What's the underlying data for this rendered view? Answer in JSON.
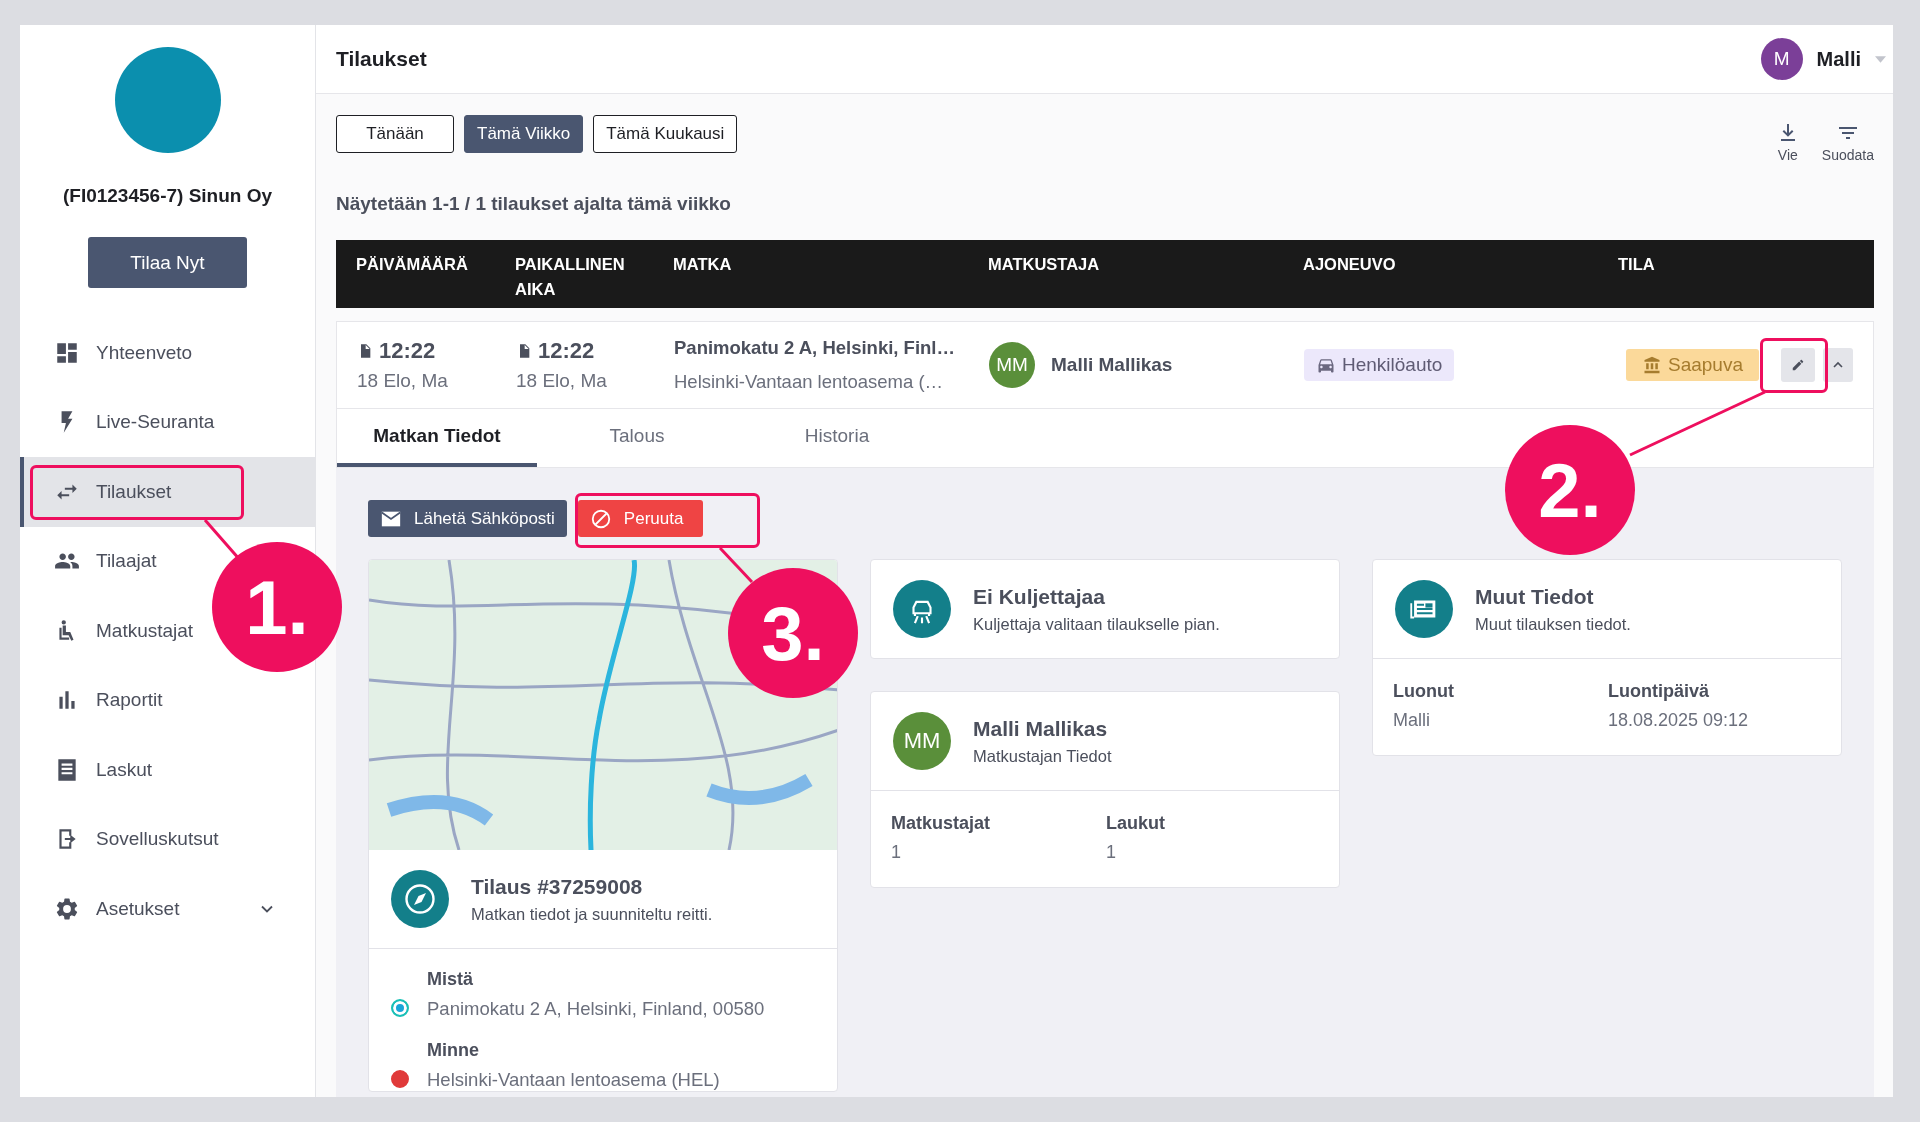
{
  "sidebar": {
    "company": "(FI0123456-7) Sinun Oy",
    "order_button": "Tilaa Nyt",
    "items": [
      {
        "label": "Yhteenveto",
        "kind": "dashboard",
        "selected": false
      },
      {
        "label": "Live-Seuranta",
        "kind": "bolt",
        "selected": false
      },
      {
        "label": "Tilaukset",
        "kind": "swap",
        "selected": true
      },
      {
        "label": "Tilaajat",
        "kind": "people",
        "selected": false
      },
      {
        "label": "Matkustajat",
        "kind": "seat",
        "selected": false
      },
      {
        "label": "Raportit",
        "kind": "bars",
        "selected": false
      },
      {
        "label": "Laskut",
        "kind": "receipt",
        "selected": false
      },
      {
        "label": "Sovelluskutsut",
        "kind": "exit",
        "selected": false
      },
      {
        "label": "Asetukset",
        "kind": "gear",
        "selected": false,
        "expanded": false
      }
    ]
  },
  "header": {
    "title": "Tilaukset",
    "user": {
      "initial": "M",
      "name": "Malli"
    }
  },
  "periods": [
    {
      "label": "Tänään",
      "selected": false
    },
    {
      "label": "Tämä Viikko",
      "selected": true
    },
    {
      "label": "Tämä Kuukausi",
      "selected": false
    }
  ],
  "actions": [
    {
      "label": "Vie",
      "kind": "download"
    },
    {
      "label": "Suodata",
      "kind": "filter"
    }
  ],
  "summary": "Näytetään 1-1 / 1 tilaukset ajalta tämä viikko",
  "table": {
    "columns": [
      "PÄIVÄMÄÄRÄ",
      "PAIKALLINEN AIKA",
      "MATKA",
      "MATKUSTAJA",
      "AJONEUVO",
      "TILA"
    ],
    "rows": [
      {
        "time": "12:22",
        "date": "18 Elo, Ma",
        "local_time": "12:22",
        "local_date": "18 Elo, Ma",
        "from": "Panimokatu 2 A, Helsinki, Finl…",
        "to": "Helsinki-Vantaan lentoasema (…",
        "passenger_initials": "MM",
        "passenger": "Malli Mallikas",
        "vehicle": "Henkilöauto",
        "status": "Saapuva",
        "expanded": true
      }
    ]
  },
  "detail_tabs": [
    {
      "label": "Matkan Tiedot",
      "selected": true
    },
    {
      "label": "Talous",
      "selected": false
    },
    {
      "label": "Historia",
      "selected": false
    }
  ],
  "detail_actions": [
    {
      "label": "Lähetä Sähköposti",
      "kind": "email"
    },
    {
      "label": "Peruuta",
      "kind": "cancel"
    }
  ],
  "order_card": {
    "title": "Tilaus #37259008",
    "subtitle": "Matkan tiedot ja suunniteltu reitti.",
    "stops": [
      {
        "label": "Mistä",
        "address": "Panimokatu 2 A, Helsinki, Finland, 00580",
        "kind": "origin"
      },
      {
        "label": "Minne",
        "address": "Helsinki-Vantaan lentoasema (HEL)",
        "kind": "destination"
      }
    ]
  },
  "driver_card": {
    "title": "Ei Kuljettajaa",
    "subtitle": "Kuljettaja valitaan tilaukselle pian."
  },
  "passenger_card": {
    "initials": "MM",
    "title": "Malli Mallikas",
    "subtitle": "Matkustajan Tiedot",
    "fields": [
      {
        "label": "Matkustajat",
        "value": "1"
      },
      {
        "label": "Laukut",
        "value": "1"
      }
    ]
  },
  "info_card": {
    "title": "Muut Tiedot",
    "subtitle": "Muut tilauksen tiedot.",
    "fields": [
      {
        "label": "Luonut",
        "value": "Malli"
      },
      {
        "label": "Luontipäivä",
        "value": "18.08.2025 09:12"
      }
    ]
  },
  "annotations": [
    {
      "label": "1."
    },
    {
      "label": "2."
    },
    {
      "label": "3."
    }
  ]
}
